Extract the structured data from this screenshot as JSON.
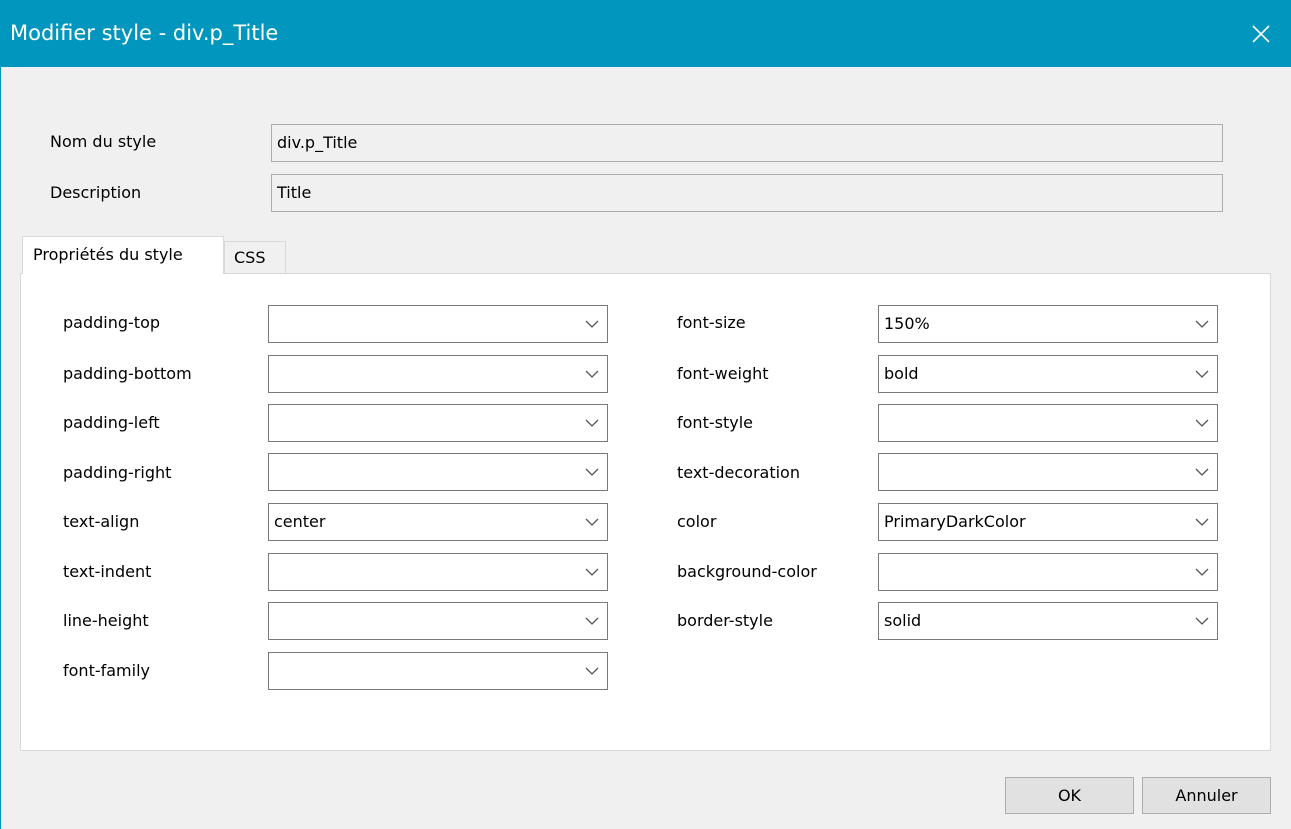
{
  "dialog": {
    "title": "Modifier style - div.p_Title",
    "close_label": "×"
  },
  "fields": {
    "name_label": "Nom du style",
    "name_value": "div.p_Title",
    "description_label": "Description",
    "description_value": "Title"
  },
  "tabs": [
    {
      "label": "Propriétés du style",
      "active": true
    },
    {
      "label": "CSS",
      "active": false
    }
  ],
  "properties_left": [
    {
      "label": "padding-top",
      "value": ""
    },
    {
      "label": "padding-bottom",
      "value": ""
    },
    {
      "label": "padding-left",
      "value": ""
    },
    {
      "label": "padding-right",
      "value": ""
    },
    {
      "label": "text-align",
      "value": "center"
    },
    {
      "label": "text-indent",
      "value": ""
    },
    {
      "label": "line-height",
      "value": ""
    },
    {
      "label": "font-family",
      "value": ""
    }
  ],
  "properties_right": [
    {
      "label": "font-size",
      "value": "150%"
    },
    {
      "label": "font-weight",
      "value": "bold"
    },
    {
      "label": "font-style",
      "value": ""
    },
    {
      "label": "text-decoration",
      "value": ""
    },
    {
      "label": "color",
      "value": "PrimaryDarkColor"
    },
    {
      "label": "background-color",
      "value": ""
    },
    {
      "label": "border-style",
      "value": "solid"
    }
  ],
  "buttons": {
    "ok": "OK",
    "cancel": "Annuler"
  },
  "colors": {
    "titlebar": "#0096bd",
    "dialog_bg": "#f0f0f0",
    "panel_bg": "#ffffff"
  },
  "icons": {
    "close": "close-icon",
    "dropdown": "chevron-down-icon"
  }
}
